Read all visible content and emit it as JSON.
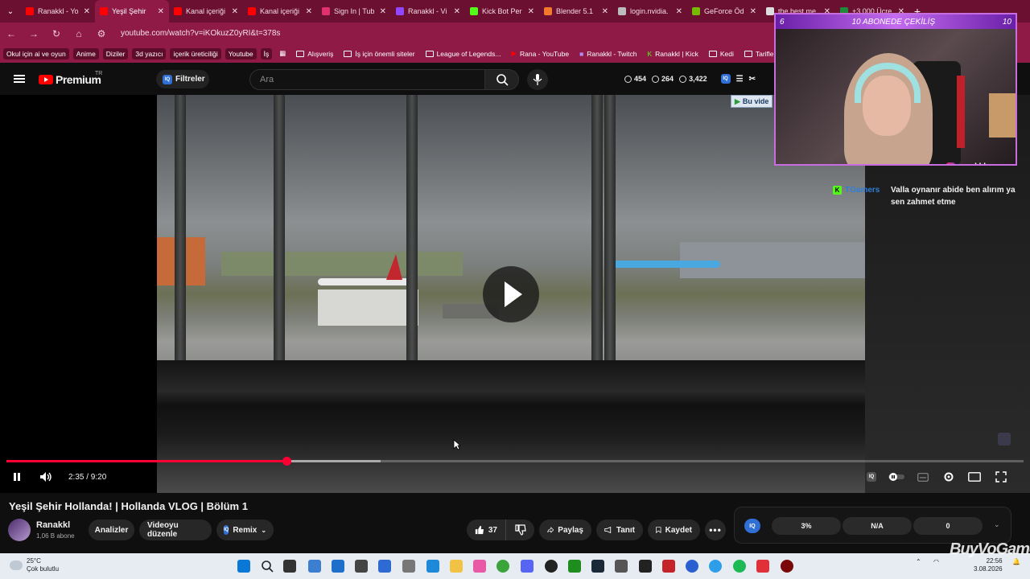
{
  "tabs": [
    {
      "label": "Ranakkl - Yo",
      "color": "#ff0000",
      "active": false
    },
    {
      "label": "Yeşil Şehir",
      "color": "#ff0000",
      "active": true
    },
    {
      "label": "Kanal içeriği",
      "color": "#ff0000",
      "active": false
    },
    {
      "label": "Kanal içeriği",
      "color": "#ff0000",
      "active": false
    },
    {
      "label": "Sign In | Tub",
      "color": "#e0306d",
      "active": false
    },
    {
      "label": "Ranakkl - Vi",
      "color": "#9146ff",
      "active": false
    },
    {
      "label": "Kick Bot Per",
      "color": "#53fc18",
      "active": false
    },
    {
      "label": "Blender 5.1",
      "color": "#f5792a",
      "active": false
    },
    {
      "label": "login.nvidia.",
      "color": "#bbbbbb",
      "active": false
    },
    {
      "label": "GeForce Öd",
      "color": "#76b900",
      "active": false
    },
    {
      "label": "the best me",
      "color": "#dddddd",
      "active": false
    },
    {
      "label": "+3.000 Ücre",
      "color": "#1f8a3a",
      "active": false
    }
  ],
  "address": {
    "url": "youtube.com/watch?v=iKOkuzZ0yRI&t=378s"
  },
  "bookmarks": {
    "chips": [
      "Okul için ai ve oyun",
      "Anime",
      "Diziler",
      "3d yazıcı",
      "içerik üreticiliği",
      "Youtube",
      "İş"
    ],
    "items": [
      "Alışveriş",
      "İş için önemli siteler",
      "League of Legends...",
      "Rana - YouTube",
      "Ranakkl - Twitch",
      "Ranakkl | Kick",
      "Kedi",
      "Tarifler"
    ]
  },
  "header": {
    "brand": "Premium",
    "region": "TR",
    "filter_label": "Filtreler",
    "search_placeholder": "Ara",
    "stats": [
      "454",
      "264",
      "3,422"
    ]
  },
  "player": {
    "time": "2:35 / 9:20",
    "progress": 0.275,
    "buffered": 0.368,
    "overlay_badge": "Bu vide"
  },
  "cam": {
    "banner_left": "6",
    "banner_title": "10 ABONEDE ÇEKİLİŞ",
    "banner_right": "10",
    "instagram": "ranakkl"
  },
  "chat": {
    "user": "TGamers",
    "message": "Valla oynanır abide ben alırım ya sen zahmet etme"
  },
  "video": {
    "title": "Yeşil Şehir Hollanda! | Hollanda VLOG | Bölüm 1",
    "channel": "Ranakkl",
    "subscribers": "1,06 B abone",
    "analytics": "Analizler",
    "edit": "Videoyu düzenle",
    "remix": "Remix",
    "likes": "37",
    "share": "Paylaş",
    "promote": "Tanıt",
    "save": "Kaydet"
  },
  "iq_panel": {
    "values": [
      "3%",
      "N/A",
      "0"
    ]
  },
  "taskbar": {
    "temp": "25°C",
    "weather": "Çok bulutlu",
    "time": "22:56",
    "date": "3.08.2026",
    "watermark": "BuyVoGame"
  },
  "colors": {
    "accent": "#ff0033",
    "tab_bg": "#6b1030",
    "toolbar": "#8e1a45"
  }
}
